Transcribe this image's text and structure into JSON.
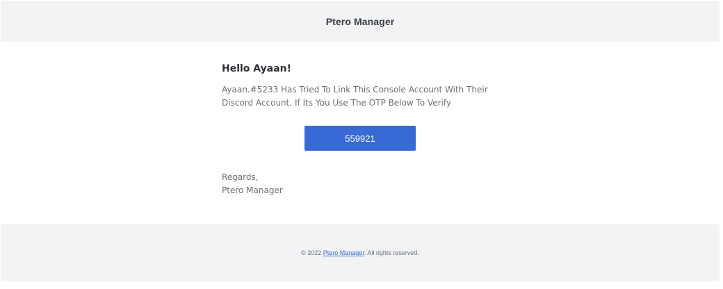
{
  "header": {
    "title": "Ptero Manager"
  },
  "email": {
    "greeting": "Hello Ayaan!",
    "message": "Ayaan.#5233 Has Tried To Link This Console Account With Their Discord Account. If Its You Use The OTP Below To Verify",
    "otp": "559921",
    "regards_line": "Regards,",
    "signature": "Ptero Manager"
  },
  "footer": {
    "prefix": "© 2022 ",
    "link_text": "Ptero Manager",
    "suffix": ". All rights reserved."
  },
  "colors": {
    "accent": "#3869d4",
    "band_background": "#f2f3f5",
    "body_text": "#6b6f75",
    "heading_text": "#2d3035"
  }
}
